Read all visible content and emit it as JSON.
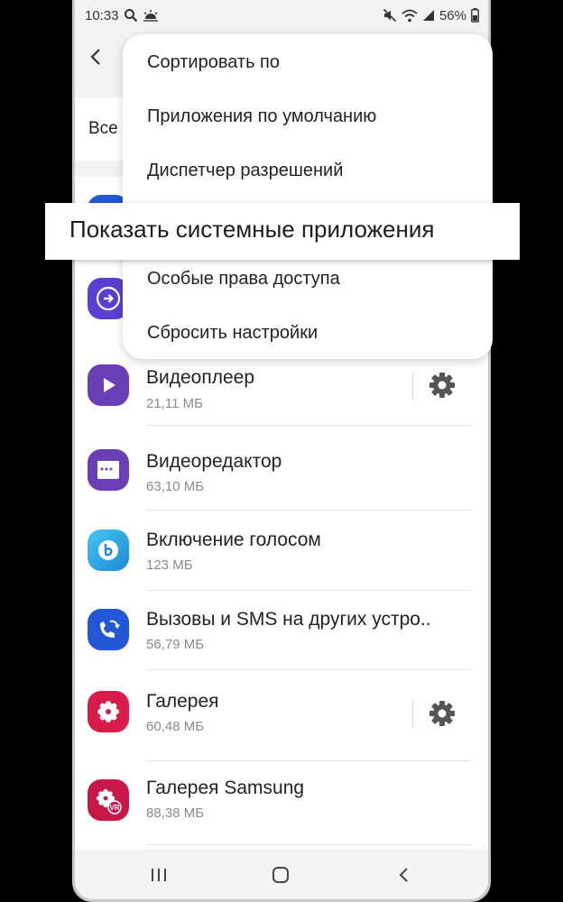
{
  "status_bar": {
    "time": "10:33",
    "left_icons": [
      "search-icon",
      "weather-icon"
    ],
    "right_icons": [
      "mute-icon",
      "wifi-icon",
      "signal-icon"
    ],
    "battery": "56%"
  },
  "filter": {
    "label": "Все"
  },
  "menu": {
    "items": [
      "Сортировать по",
      "Приложения по умолчанию",
      "Диспетчер разрешений",
      "Показать системные приложения",
      "Особые права доступа",
      "Сбросить настройки"
    ]
  },
  "apps": [
    {
      "name": "Видеоплеер",
      "size": "21,11 МБ",
      "icon": "play-icon",
      "color": "#6a3fb5",
      "has_settings": true
    },
    {
      "name": "Видеоредактор",
      "size": "63,10 МБ",
      "icon": "clapperboard-icon",
      "color": "#6a3fb5",
      "has_settings": false
    },
    {
      "name": "Включение голосом",
      "size": "123 МБ",
      "icon": "bixby-icon",
      "color": "#2fa8e8",
      "has_settings": false
    },
    {
      "name": "Вызовы и SMS на других устро..",
      "size": "56,79 МБ",
      "icon": "call-sync-icon",
      "color": "#2357d6",
      "has_settings": false
    },
    {
      "name": "Галерея",
      "size": "60,48 МБ",
      "icon": "flower-icon",
      "color": "#d81b4a",
      "has_settings": true
    },
    {
      "name": "Галерея Samsung",
      "size": "88,38 МБ",
      "icon": "vr-gallery-icon",
      "color": "#c8184a",
      "has_settings": false
    }
  ],
  "navbar": {
    "buttons": [
      "recents-button",
      "home-button",
      "back-button"
    ]
  }
}
